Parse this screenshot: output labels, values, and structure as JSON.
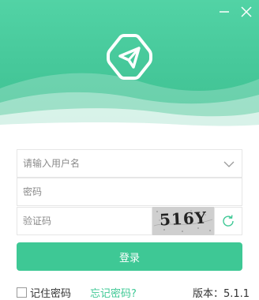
{
  "window": {
    "minimize_icon": "minimize-icon",
    "close_icon": "close-icon"
  },
  "header": {
    "logo_icon": "paper-plane-icon",
    "colors": {
      "gradient_top": "#52d3a5",
      "gradient_bottom": "#3dbf8f",
      "logo_stroke": "#ffffff"
    }
  },
  "form": {
    "username": {
      "placeholder": "请输入用户名",
      "value": "",
      "dropdown_icon": "chevron-down-icon"
    },
    "password": {
      "placeholder": "密码",
      "value": ""
    },
    "captcha": {
      "placeholder": "验证码",
      "value": "",
      "image_text": "516Y",
      "refresh_icon": "refresh-icon"
    },
    "login_label": "登录",
    "remember_label": "记住密码",
    "remember_checked": false,
    "forgot_label": "忘记密码?",
    "version_text": "版本：5.1.1"
  },
  "colors": {
    "accent": "#3ec895",
    "border": "#e6e6e6",
    "placeholder": "#8a8a8a",
    "text": "#333333"
  }
}
